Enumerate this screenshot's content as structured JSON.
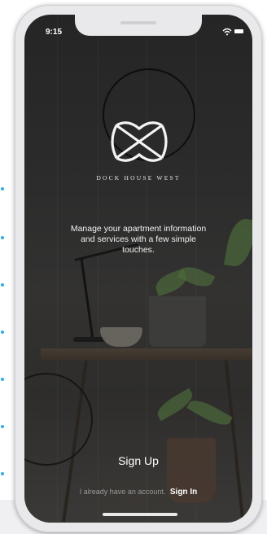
{
  "status_bar": {
    "time": "9:15"
  },
  "brand": {
    "name": "DOCK HOUSE WEST",
    "logo": "interlaced-knot-icon"
  },
  "tagline": "Manage your apartment information and services with a few simple touches.",
  "actions": {
    "sign_up_label": "Sign Up",
    "have_account_text": "I already have an account.",
    "sign_in_label": "Sign In"
  },
  "colors": {
    "accent_dots": "#33aee3",
    "overlay": "#2a2a2a",
    "text": "#ffffff"
  },
  "icons": [
    "wifi-icon",
    "battery-icon",
    "interlaced-knot-icon"
  ]
}
